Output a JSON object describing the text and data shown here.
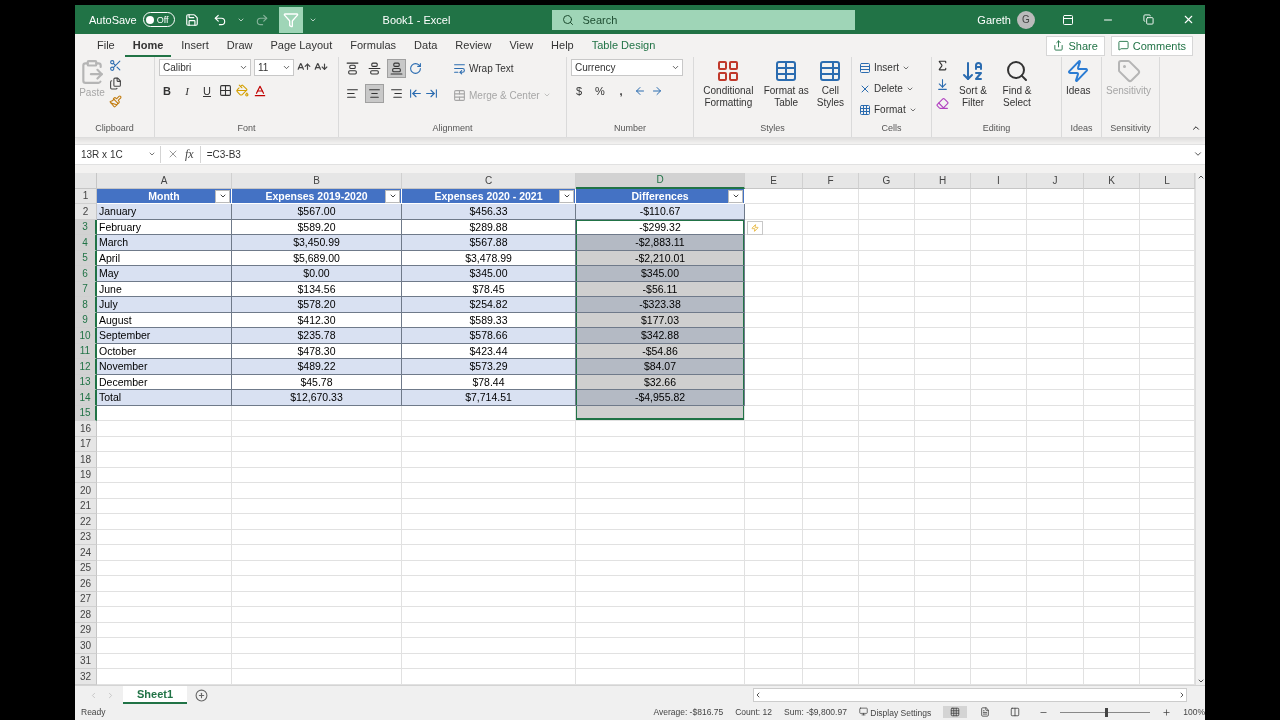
{
  "title_bar": {
    "autosave_label": "AutoSave",
    "autosave_on": false,
    "autosave_state": "Off",
    "redo_disabled": true,
    "filter_active": true,
    "title": "Book1  -  Excel",
    "search_placeholder": "Search",
    "user": "Gareth",
    "avatar": "G"
  },
  "menu_tabs": [
    {
      "label": "File",
      "selected": false,
      "kind": "normal"
    },
    {
      "label": "Home",
      "selected": true,
      "kind": "normal"
    },
    {
      "label": "Insert",
      "selected": false,
      "kind": "normal"
    },
    {
      "label": "Draw",
      "selected": false,
      "kind": "normal"
    },
    {
      "label": "Page Layout",
      "selected": false,
      "kind": "normal"
    },
    {
      "label": "Formulas",
      "selected": false,
      "kind": "normal"
    },
    {
      "label": "Data",
      "selected": false,
      "kind": "normal"
    },
    {
      "label": "Review",
      "selected": false,
      "kind": "normal"
    },
    {
      "label": "View",
      "selected": false,
      "kind": "normal"
    },
    {
      "label": "Help",
      "selected": false,
      "kind": "normal"
    },
    {
      "label": "Table Design",
      "selected": false,
      "kind": "contextual"
    }
  ],
  "actions": [
    {
      "kind": "share",
      "label": "Share"
    },
    {
      "kind": "comments",
      "label": "Comments"
    }
  ],
  "ribbon": {
    "clipboard": {
      "paste": "Paste",
      "paste_disabled": true,
      "label": "Clipboard"
    },
    "font": {
      "name": "Calibri",
      "size": "11",
      "bold": "B",
      "italic": "I",
      "underline": "U",
      "label": "Font"
    },
    "alignment": {
      "vertical": [
        {
          "kind": "top",
          "pressed": false
        },
        {
          "kind": "middle",
          "pressed": false
        },
        {
          "kind": "bottom",
          "pressed": true
        }
      ],
      "horizontal": [
        {
          "kind": "left",
          "pressed": false
        },
        {
          "kind": "center",
          "pressed": true
        },
        {
          "kind": "right",
          "pressed": false
        }
      ],
      "wrap_text": "Wrap Text",
      "merge": "Merge & Center",
      "merge_disabled": true,
      "label": "Alignment"
    },
    "number": {
      "format": "Currency",
      "currency": "$",
      "percent": "%",
      "comma": ",",
      "label": "Number"
    },
    "styles": {
      "buttons": [
        {
          "kind": "conditional",
          "label": "Conditional Formatting"
        },
        {
          "kind": "table",
          "label": "Format as Table"
        },
        {
          "kind": "cell",
          "label": "Cell Styles"
        }
      ],
      "label": "Styles"
    },
    "cells": {
      "buttons": [
        {
          "kind": "insert",
          "label": "Insert"
        },
        {
          "kind": "delete",
          "label": "Delete"
        },
        {
          "kind": "format",
          "label": "Format"
        }
      ],
      "label": "Cells"
    },
    "editing": {
      "sort": "Sort & Filter",
      "find": "Find & Select",
      "label": "Editing"
    },
    "ideas": {
      "button": "Ideas",
      "label": "Ideas"
    },
    "sensitivity": {
      "button": "Sensitivity",
      "disabled": true,
      "label": "Sensitivity"
    }
  },
  "formula_bar": {
    "name_box": "13R x 1C",
    "fx": "fx",
    "formula": "=C3-B3"
  },
  "sheet": {
    "columns": [
      {
        "letter": "A",
        "selected": false
      },
      {
        "letter": "B",
        "selected": false
      },
      {
        "letter": "C",
        "selected": false
      },
      {
        "letter": "D",
        "selected": true
      },
      {
        "letter": "E",
        "selected": false
      },
      {
        "letter": "F",
        "selected": false
      },
      {
        "letter": "G",
        "selected": false
      },
      {
        "letter": "H",
        "selected": false
      },
      {
        "letter": "I",
        "selected": false
      },
      {
        "letter": "J",
        "selected": false
      },
      {
        "letter": "K",
        "selected": false
      },
      {
        "letter": "L",
        "selected": false
      }
    ],
    "row_numbers": [
      "1",
      "2",
      "3",
      "4",
      "5",
      "6",
      "7",
      "8",
      "9",
      "10",
      "11",
      "12",
      "13",
      "14",
      "15",
      "16",
      "17",
      "18",
      "19",
      "20",
      "21",
      "22",
      "23",
      "24",
      "25",
      "26",
      "27",
      "28",
      "29",
      "30",
      "31",
      "32"
    ],
    "table": {
      "headers": [
        "Month",
        "Expenses 2019-2020",
        "Expenses 2020 - 2021",
        "Differences"
      ],
      "rows": [
        {
          "cells": [
            "January",
            "$567.00",
            "$456.33",
            "-$110.67"
          ],
          "selected": false,
          "active": false
        },
        {
          "cells": [
            "February",
            "$589.20",
            "$289.88",
            "-$299.32"
          ],
          "selected": true,
          "active": true
        },
        {
          "cells": [
            "March",
            "$3,450.99",
            "$567.88",
            "-$2,883.11"
          ],
          "selected": true,
          "active": false
        },
        {
          "cells": [
            "April",
            "$5,689.00",
            "$3,478.99",
            "-$2,210.01"
          ],
          "selected": true,
          "active": false
        },
        {
          "cells": [
            "May",
            "$0.00",
            "$345.00",
            "$345.00"
          ],
          "selected": true,
          "active": false
        },
        {
          "cells": [
            "June",
            "$134.56",
            "$78.45",
            "-$56.11"
          ],
          "selected": true,
          "active": false
        },
        {
          "cells": [
            "July",
            "$578.20",
            "$254.82",
            "-$323.38"
          ],
          "selected": true,
          "active": false
        },
        {
          "cells": [
            "August",
            "$412.30",
            "$589.33",
            "$177.03"
          ],
          "selected": true,
          "active": false
        },
        {
          "cells": [
            "September",
            "$235.78",
            "$578.66",
            "$342.88"
          ],
          "selected": true,
          "active": false
        },
        {
          "cells": [
            "October",
            "$478.30",
            "$423.44",
            "-$54.86"
          ],
          "selected": true,
          "active": false
        },
        {
          "cells": [
            "November",
            "$489.22",
            "$573.29",
            "$84.07"
          ],
          "selected": true,
          "active": false
        },
        {
          "cells": [
            "December",
            "$45.78",
            "$78.44",
            "$32.66"
          ],
          "selected": true,
          "active": false
        },
        {
          "cells": [
            "Total",
            "$12,670.33",
            "$7,714.51",
            "-$4,955.82"
          ],
          "selected": true,
          "active": false
        }
      ]
    },
    "blank_row_selected": true
  },
  "sheet_tabs": [
    {
      "label": "Sheet1",
      "selected": true
    }
  ],
  "status_bar": {
    "mode": "Ready",
    "stats": [
      "Average: -$816.75",
      "Count: 12",
      "Sum: -$9,800.97"
    ],
    "display_settings": "Display Settings",
    "views": [
      {
        "kind": "normal",
        "selected": true
      },
      {
        "kind": "page_layout",
        "selected": false
      },
      {
        "kind": "page_break",
        "selected": false
      }
    ],
    "zoom": {
      "level": 0.5
    },
    "zoom_label": "100%"
  }
}
